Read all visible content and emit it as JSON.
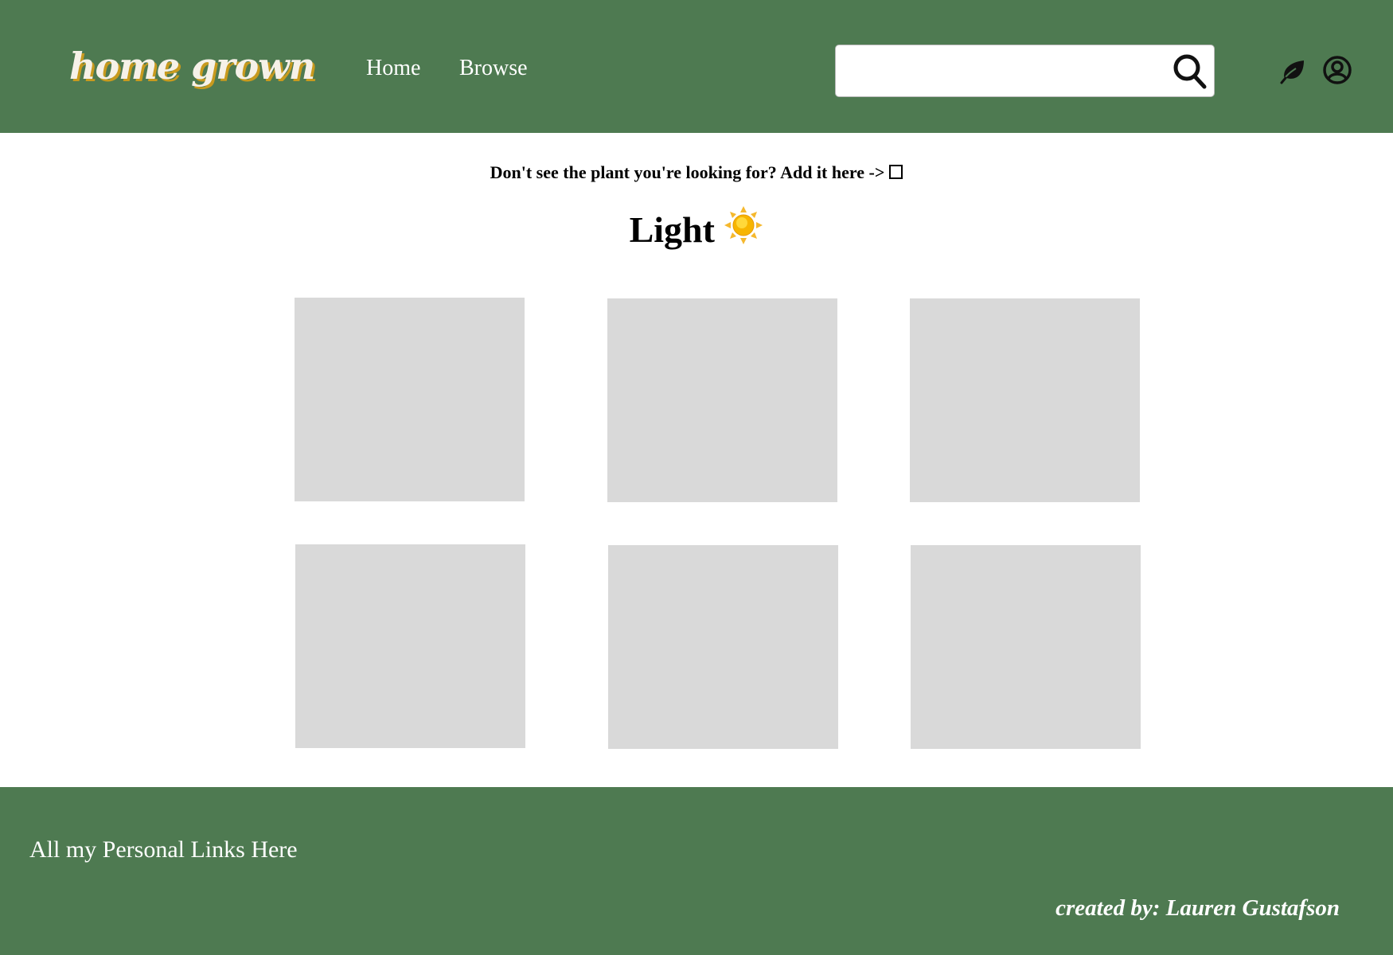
{
  "header": {
    "logo": "home grown",
    "nav": [
      {
        "label": "Home"
      },
      {
        "label": "Browse"
      }
    ],
    "search": {
      "value": "",
      "placeholder": "",
      "icon": "search-icon"
    },
    "icons": [
      "leaf-icon",
      "user-account-icon"
    ],
    "bg_color": "#4e7a51"
  },
  "main": {
    "notice": "Don't see the plant you're looking for? Add it here ->",
    "notice_icon": "empty-square-icon",
    "title": "Light",
    "title_icon": "sun-emoji",
    "cards": [
      {},
      {},
      {},
      {},
      {},
      {}
    ]
  },
  "footer": {
    "links": "All my Personal Links Here",
    "credit": "created by: Lauren Gustafson"
  }
}
